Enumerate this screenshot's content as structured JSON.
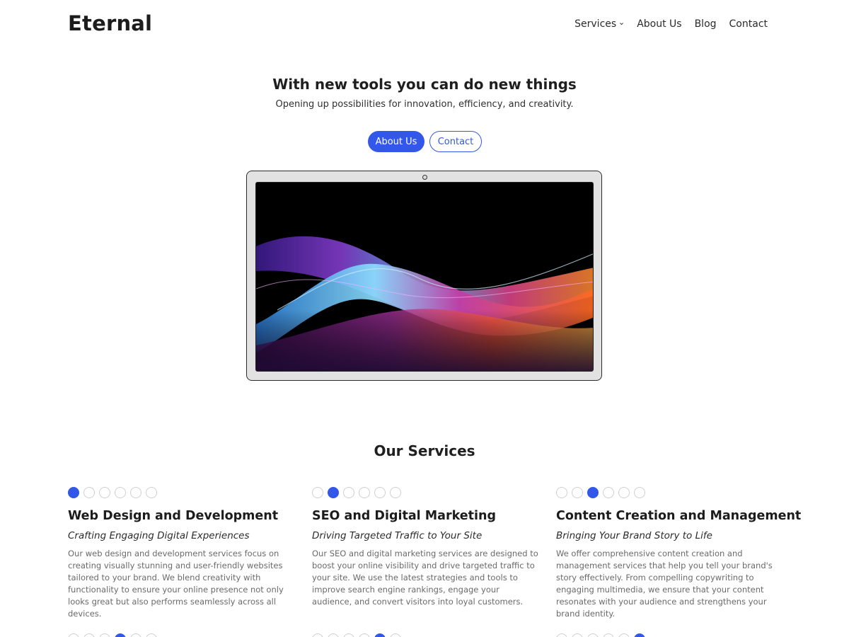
{
  "brand": {
    "logo": "Eternal",
    "accent_color": "#3357e8"
  },
  "nav": {
    "items": [
      {
        "label": "Services",
        "has_dropdown": true
      },
      {
        "label": "About Us"
      },
      {
        "label": "Blog"
      },
      {
        "label": "Contact"
      }
    ]
  },
  "hero": {
    "title": "With new tools you can do new things",
    "subtitle": "Opening up possibilities for innovation, efficiency, and creativity.",
    "primary_button": "About Us",
    "secondary_button": "Contact"
  },
  "services": {
    "title": "Our Services",
    "cards": [
      {
        "active_dot": 1,
        "title": "Web Design and Development",
        "subtitle": "Crafting Engaging Digital Experiences",
        "text": "Our web design and development services focus on creating visually stunning and user-friendly websites tailored to your brand. We blend creativity with functionality to ensure your online presence not only looks great but also performs seamlessly across all devices."
      },
      {
        "active_dot": 2,
        "title": "SEO and Digital Marketing",
        "subtitle": "Driving Targeted Traffic to Your Site",
        "text": "Our SEO and digital marketing services are designed to boost your online visibility and drive targeted traffic to your site. We use the latest strategies and tools to improve search engine rankings, engage your audience, and convert visitors into loyal customers."
      },
      {
        "active_dot": 3,
        "title": "Content Creation and Management",
        "subtitle": "Bringing Your Brand Story to Life",
        "text": "We offer comprehensive content creation and management services that help you tell your brand's story effectively. From compelling copywriting to engaging multimedia, we ensure that your content resonates with your audience and strengthens your brand identity."
      }
    ],
    "second_row_active_dots": [
      4,
      5,
      6
    ]
  }
}
